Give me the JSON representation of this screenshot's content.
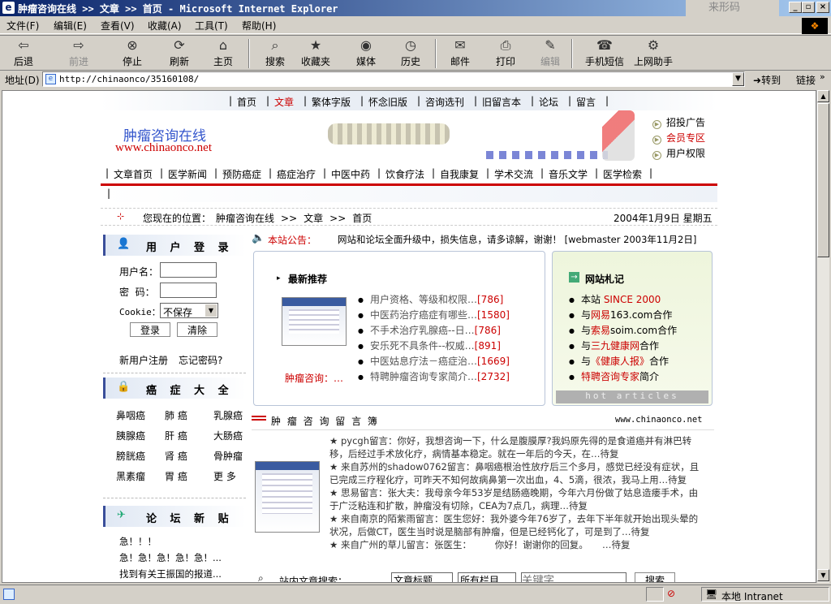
{
  "window": {
    "title": "肿瘤咨询在线 >> 文章 >> 首页 - Microsoft Internet Explorer",
    "ime_text": "来形码"
  },
  "menu": [
    "文件(F)",
    "编辑(E)",
    "查看(V)",
    "收藏(A)",
    "工具(T)",
    "帮助(H)"
  ],
  "toolbar": [
    {
      "label": "后退",
      "icon": "back-arrow-icon",
      "glyph": "⇦",
      "disabled": false
    },
    {
      "label": "前进",
      "icon": "forward-arrow-icon",
      "glyph": "⇨",
      "disabled": true
    },
    {
      "label": "停止",
      "icon": "stop-icon",
      "glyph": "⊗",
      "disabled": false
    },
    {
      "label": "刷新",
      "icon": "refresh-icon",
      "glyph": "⟳",
      "disabled": false
    },
    {
      "label": "主页",
      "icon": "home-icon",
      "glyph": "⌂",
      "disabled": false
    },
    {
      "label": "搜索",
      "icon": "search-icon",
      "glyph": "⌕",
      "disabled": false
    },
    {
      "label": "收藏夹",
      "icon": "favorites-icon",
      "glyph": "★",
      "disabled": false
    },
    {
      "label": "媒体",
      "icon": "media-icon",
      "glyph": "◉",
      "disabled": false
    },
    {
      "label": "历史",
      "icon": "history-icon",
      "glyph": "◷",
      "disabled": false
    },
    {
      "label": "邮件",
      "icon": "mail-icon",
      "glyph": "✉",
      "disabled": false
    },
    {
      "label": "打印",
      "icon": "print-icon",
      "glyph": "⎙",
      "disabled": false
    },
    {
      "label": "编辑",
      "icon": "edit-icon",
      "glyph": "✎",
      "disabled": true
    },
    {
      "label": "手机短信",
      "icon": "phone-icon",
      "glyph": "☎",
      "disabled": false
    },
    {
      "label": "上网助手",
      "icon": "assistant-icon",
      "glyph": "⚙",
      "disabled": false
    }
  ],
  "address": {
    "label": "地址(D)",
    "url": "http://chinaonco/35160108/",
    "go": "转到",
    "links": "链接"
  },
  "site": {
    "topnav": [
      "首页",
      "文章",
      "繁体字版",
      "怀念旧版",
      "咨询选刊",
      "旧留言本",
      "论坛",
      "留言"
    ],
    "logo_cn": "肿瘤咨询在线",
    "logo_url": "www.chinaonco.net",
    "side_links": [
      "招投广告",
      "会员专区",
      "用户权限"
    ],
    "catnav": [
      "文章首页",
      "医学新闻",
      "预防癌症",
      "癌症治疗",
      "中医中药",
      "饮食疗法",
      "自我康复",
      "学术交流",
      "音乐文学",
      "医学检索"
    ],
    "location_label": "您现在的位置：",
    "crumbs": [
      "肿瘤咨询在线",
      ">>",
      "文章",
      ">>",
      "首页"
    ],
    "date": "2004年1月9日 星期五",
    "notice_label": "本站公告：",
    "notice_text": "网站和论坛全面升级中，损失信息，请多谅解，谢谢！ [webmaster 2003年11月2日]",
    "login": {
      "title": "用 户 登 录",
      "user_label": "用户名：",
      "pass_label": "密  码：",
      "cookie_label": "Cookie：",
      "cookie_value": "不保存",
      "login_btn": "登录",
      "clear_btn": "清除",
      "register": "新用户注册",
      "forgot": "忘记密码?"
    },
    "cancer": {
      "title": "癌 症 大 全",
      "items": [
        "鼻咽癌",
        "肺 癌",
        "乳腺癌",
        "胰腺癌",
        "肝 癌",
        "大肠癌",
        "膀胱癌",
        "肾 癌",
        "骨肿瘤",
        "黑素瘤",
        "胃 癌",
        "更 多"
      ]
    },
    "forum": {
      "title": "论 坛 新 贴",
      "items": [
        "急！！！",
        "急！急！急！急！急！...",
        "找到有关王振国的报道..."
      ]
    },
    "recommend": {
      "title": "最新推荐",
      "thumb_caption": "肿瘤咨询：…",
      "items": [
        {
          "text": "用户资格、等级和权限…",
          "count": "[786]"
        },
        {
          "text": "中医药治疗癌症有哪些…",
          "count": "[1580]"
        },
        {
          "text": "不手术治疗乳腺癌--日…",
          "count": "[786]"
        },
        {
          "text": "安乐死不具条件--权威…",
          "count": "[891]"
        },
        {
          "text": "中医姑息疗法－癌症治…",
          "count": "[1669]"
        },
        {
          "text": "特聘肿瘤咨询专家简介…",
          "count": "[2732]"
        }
      ]
    },
    "journal": {
      "title": "网站札记",
      "items": [
        {
          "a": "本站 ",
          "b": "SINCE 2000",
          "c": ""
        },
        {
          "a": "与",
          "b": "网易",
          "c": "163.com合作"
        },
        {
          "a": "与",
          "b": "索易",
          "c": "soim.com合作"
        },
        {
          "a": "与",
          "b": "三九健康网",
          "c": "合作"
        },
        {
          "a": "与",
          "b": "《健康人报》",
          "c": "合作"
        },
        {
          "a": "",
          "b": "特聘咨询专家",
          "c": "简介"
        }
      ],
      "footer": "hot articles"
    },
    "guestbook": {
      "title": "肿 瘤 咨 询 留 言 簿",
      "url": "www.chinaonco.net",
      "entries": [
        "★ pycgh留言：你好，我想咨询一下，什么是腹膜厚?我妈原先得的是食道癌并有淋巴转移，后经过手术放化疗，病情基本稳定。就在一年后的今天，在…待复",
        "★ 来自苏州的shadow0762留言：鼻咽癌根治性放疗后三个多月，感觉已经没有症状，且已完成三疗程化疗，可昨天不知何故病鼻第一次出血，4、5滴，很浓，我马上用…待复",
        "★ 思易留言：张大夫：我母亲今年53岁是结肠癌晚期，今年六月份做了姑息造瘘手术，由于广泛粘连和扩散，肿瘤没有切除，CEA为7点几，病理…待复",
        "★ 来自南京的陌紫雨留言：医生您好：我外婆今年76岁了，去年下半年就开始出现头晕的状况，后做CT，医生当时说是脑部有肿瘤，但是已经钙化了，可是到了…待复",
        "★ 来自广州的草儿留言：张医生：　　　你好！谢谢你的回复。　　…待复"
      ]
    },
    "search": {
      "label": "站内文章搜索：",
      "field": "文章标题",
      "column": "所有栏目",
      "placeholder": "关键字",
      "button": "搜索"
    }
  },
  "status": {
    "zone": "本地 Intranet"
  }
}
